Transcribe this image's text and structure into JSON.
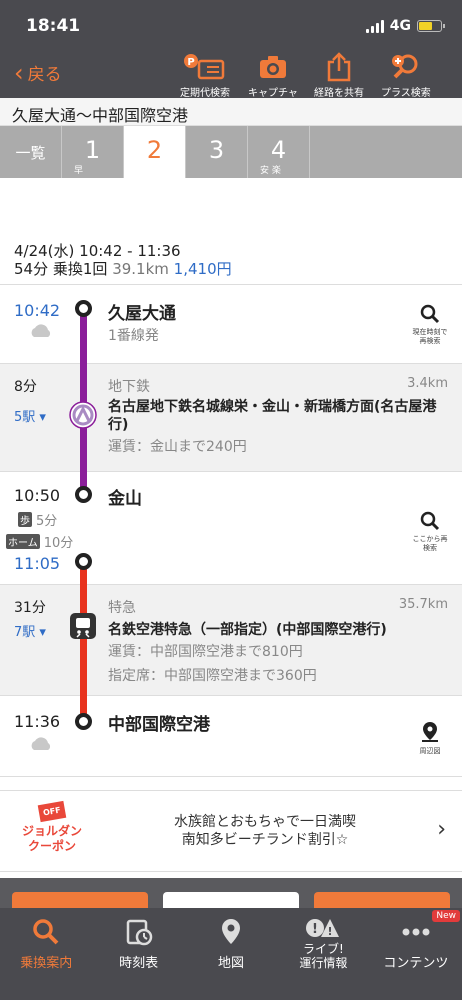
{
  "status_bar": {
    "time": "18:41",
    "network": "4G"
  },
  "header": {
    "back_label": "戻る",
    "tools": [
      {
        "label": "定期代検索",
        "icon": "commuter-pass-icon"
      },
      {
        "label": "キャプチャ",
        "icon": "camera-icon"
      },
      {
        "label": "経路を共有",
        "icon": "share-icon"
      },
      {
        "label": "プラス検索",
        "icon": "plus-search-icon"
      }
    ]
  },
  "route_title": "久屋大通〜中部国際空港",
  "tabs": [
    {
      "label": "一覧",
      "sub": ""
    },
    {
      "label": "1",
      "sub": "早"
    },
    {
      "label": "2",
      "sub": ""
    },
    {
      "label": "3",
      "sub": ""
    },
    {
      "label": "4",
      "sub": "安 楽"
    }
  ],
  "summary": {
    "date_time": "4/24(水) 10:42 - 11:36",
    "duration_transfer": "54分 乗換1回",
    "distance": "39.1km",
    "fare": "1,410円"
  },
  "legs": {
    "dep": {
      "time": "10:42",
      "station": "久屋大通",
      "platform": "1番線発",
      "search_label": "現在時刻で再検索"
    },
    "seg1": {
      "duration": "8分",
      "stops": "5駅",
      "type": "地下鉄",
      "distance": "3.4km",
      "line": "名古屋地下鉄名城線栄・金山・新瑞橋方面(名古屋港行)",
      "fare": "運賃：金山まで240円"
    },
    "transfer": {
      "arr_time": "10:50",
      "station": "金山",
      "walk_badge": "歩",
      "walk_time": "5分",
      "home_badge": "ホーム",
      "home_time": "10分",
      "dep_time": "11:05",
      "search_label": "ここから再検索"
    },
    "seg2": {
      "duration": "31分",
      "stops": "7駅",
      "type": "特急",
      "distance": "35.7km",
      "line": "名鉄空港特急（一部指定）(中部国際空港行)",
      "fare": "運賃：中部国際空港まで810円",
      "reserved": "指定席：中部国際空港まで360円"
    },
    "arr": {
      "time": "11:36",
      "station": "中部国際空港",
      "map_label": "周辺図"
    }
  },
  "banner": {
    "coupon_badge": "OFF",
    "coupon_line1": "ジョルダン",
    "coupon_line2": "クーポン",
    "line1": "水族館とおもちゃで一日満喫",
    "line2": "南知多ビーチランド割引☆"
  },
  "tabbar": {
    "items": [
      {
        "label": "乗換案内",
        "icon": "route-search-icon"
      },
      {
        "label": "時刻表",
        "icon": "timetable-icon"
      },
      {
        "label": "地図",
        "icon": "map-pin-icon"
      },
      {
        "label": "ライブ!\n運行情報",
        "icon": "alert-icon"
      },
      {
        "label": "コンテンツ",
        "icon": "more-icon"
      }
    ],
    "new_badge": "New"
  },
  "colors": {
    "accent": "#f07a3a",
    "subway_line": "#8b1e9a",
    "express_line": "#e8331e",
    "link_blue": "#2f6cc6"
  }
}
